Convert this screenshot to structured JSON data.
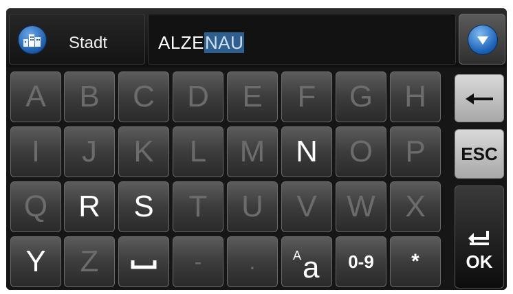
{
  "header": {
    "field_label": "Stadt",
    "typed_text": "ALZE",
    "suggestion_text": "NAU"
  },
  "keyboard": {
    "row1": [
      {
        "label": "A",
        "enabled": false
      },
      {
        "label": "B",
        "enabled": false
      },
      {
        "label": "C",
        "enabled": false
      },
      {
        "label": "D",
        "enabled": false
      },
      {
        "label": "E",
        "enabled": false
      },
      {
        "label": "F",
        "enabled": false
      },
      {
        "label": "G",
        "enabled": false
      },
      {
        "label": "H",
        "enabled": false
      }
    ],
    "row2": [
      {
        "label": "I",
        "enabled": false
      },
      {
        "label": "J",
        "enabled": false
      },
      {
        "label": "K",
        "enabled": false
      },
      {
        "label": "L",
        "enabled": false
      },
      {
        "label": "M",
        "enabled": false
      },
      {
        "label": "N",
        "enabled": true
      },
      {
        "label": "O",
        "enabled": false
      },
      {
        "label": "P",
        "enabled": false
      }
    ],
    "row3": [
      {
        "label": "Q",
        "enabled": false
      },
      {
        "label": "R",
        "enabled": true
      },
      {
        "label": "S",
        "enabled": true
      },
      {
        "label": "T",
        "enabled": false
      },
      {
        "label": "U",
        "enabled": false
      },
      {
        "label": "V",
        "enabled": false
      },
      {
        "label": "W",
        "enabled": false
      },
      {
        "label": "X",
        "enabled": false
      }
    ],
    "row4": {
      "y": "Y",
      "z": "Z",
      "dash": "-",
      "dot": ".",
      "numbers": "0-9",
      "star": "*"
    },
    "side": {
      "esc": "ESC",
      "ok": "OK"
    }
  },
  "colors": {
    "accent": "#1e63b7",
    "suggestion_bg": "#2f5f8e"
  }
}
